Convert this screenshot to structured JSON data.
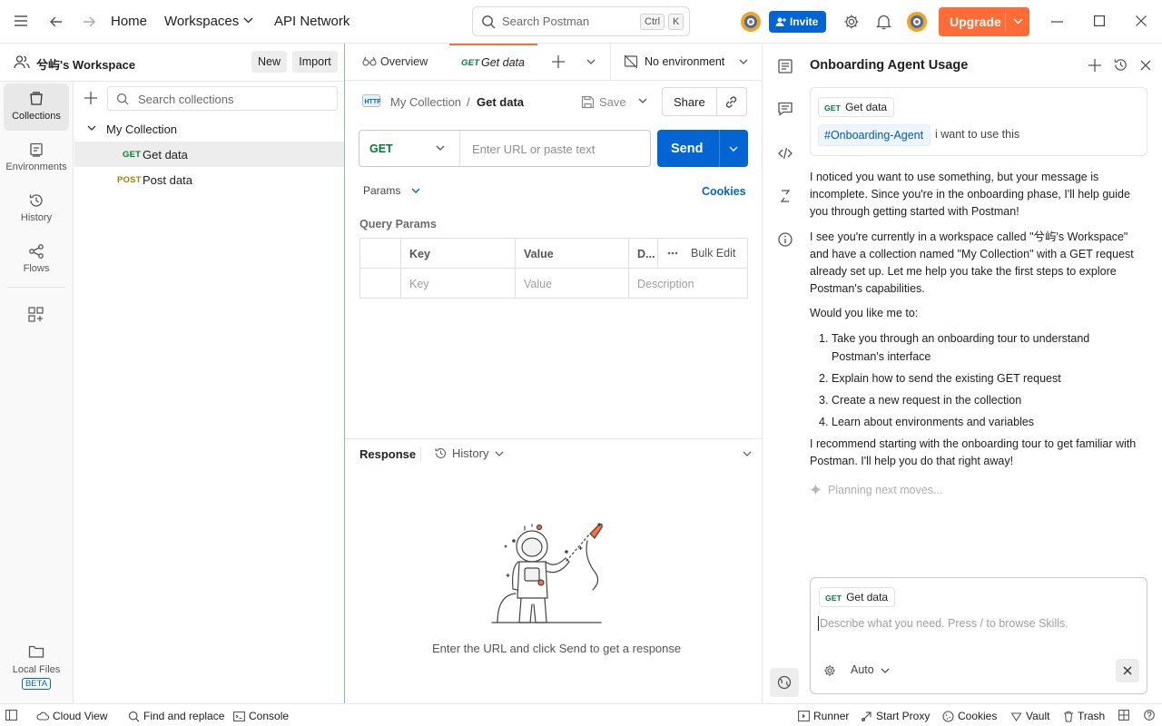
{
  "topbar": {
    "nav": {
      "home": "Home",
      "workspaces": "Workspaces",
      "api_network": "API Network"
    },
    "search": {
      "placeholder": "Search Postman",
      "kbd_ctrl": "Ctrl",
      "kbd_k": "K"
    },
    "invite_label": "Invite",
    "upgrade_label": "Upgrade",
    "colors": {
      "invite": "#0265d2",
      "upgrade": "#ff6c37"
    }
  },
  "rail": {
    "items": [
      {
        "label": "Collections",
        "icon": "collections-icon"
      },
      {
        "label": "Environments",
        "icon": "environments-icon"
      },
      {
        "label": "History",
        "icon": "history-icon"
      },
      {
        "label": "Flows",
        "icon": "flows-icon"
      }
    ],
    "local_files": {
      "label": "Local Files",
      "badge": "BETA"
    }
  },
  "sidebar": {
    "workspace_name": "兮屿's Workspace",
    "new_label": "New",
    "import_label": "Import",
    "search_placeholder": "Search collections",
    "collection_name": "My Collection",
    "requests": [
      {
        "method": "GET",
        "name": "Get data"
      },
      {
        "method": "POST",
        "name": "Post data"
      }
    ]
  },
  "tabs": {
    "overview_label": "Overview",
    "active_tab": {
      "method": "GET",
      "name": "Get data"
    },
    "environment_label": "No environment"
  },
  "request": {
    "breadcrumb_collection": "My Collection",
    "breadcrumb_separator": "/",
    "breadcrumb_request": "Get data",
    "save_label": "Save",
    "share_label": "Share",
    "method": "GET",
    "url_placeholder": "Enter URL or paste text",
    "send_label": "Send",
    "params_label": "Params",
    "cookies_label": "Cookies",
    "query_params_title": "Query Params",
    "table": {
      "headers": {
        "key": "Key",
        "value": "Value",
        "description": "D...",
        "bulk_edit": "Bulk Edit"
      },
      "placeholders": {
        "key": "Key",
        "value": "Value",
        "description": "Description"
      }
    }
  },
  "response": {
    "title": "Response",
    "history_label": "History",
    "empty_message": "Enter the URL and click Send to get a response"
  },
  "agent": {
    "title": "Onboarding Agent Usage",
    "context_chip": {
      "method": "GET",
      "name": "Get data"
    },
    "user_message": {
      "agent_tag": "#Onboarding-Agent",
      "text": "i want to use this"
    },
    "reply_p1": "I noticed you want to use something, but your message is incomplete. Since you're in the onboarding phase, I'll help guide you through getting started with Postman!",
    "reply_p2": "I see you're currently in a workspace called \"兮屿's Workspace\" and have a collection named \"My Collection\" with a GET request already set up. Let me help you take the first steps to explore Postman's capabilities.",
    "reply_p3": "Would you like me to:",
    "options": [
      {
        "num": "1.",
        "text": "Take you through an onboarding tour to understand Postman's interface"
      },
      {
        "num": "2.",
        "text": "Explain how to send the existing GET request"
      },
      {
        "num": "3.",
        "text": "Create a new request in the collection"
      },
      {
        "num": "4.",
        "text": "Learn about environments and variables"
      }
    ],
    "reply_p4": "I recommend starting with the onboarding tour to get familiar with Postman. I'll help you do that right away!",
    "status": "Planning next moves...",
    "composer": {
      "chip": {
        "method": "GET",
        "name": "Get data"
      },
      "placeholder": "Describe what you need. Press / to browse Skills.",
      "mode_label": "Auto"
    }
  },
  "statusbar": {
    "cloud_view": "Cloud View",
    "find_replace": "Find and replace",
    "console": "Console",
    "runner": "Runner",
    "start_proxy": "Start Proxy",
    "cookies": "Cookies",
    "vault": "Vault",
    "trash": "Trash"
  }
}
